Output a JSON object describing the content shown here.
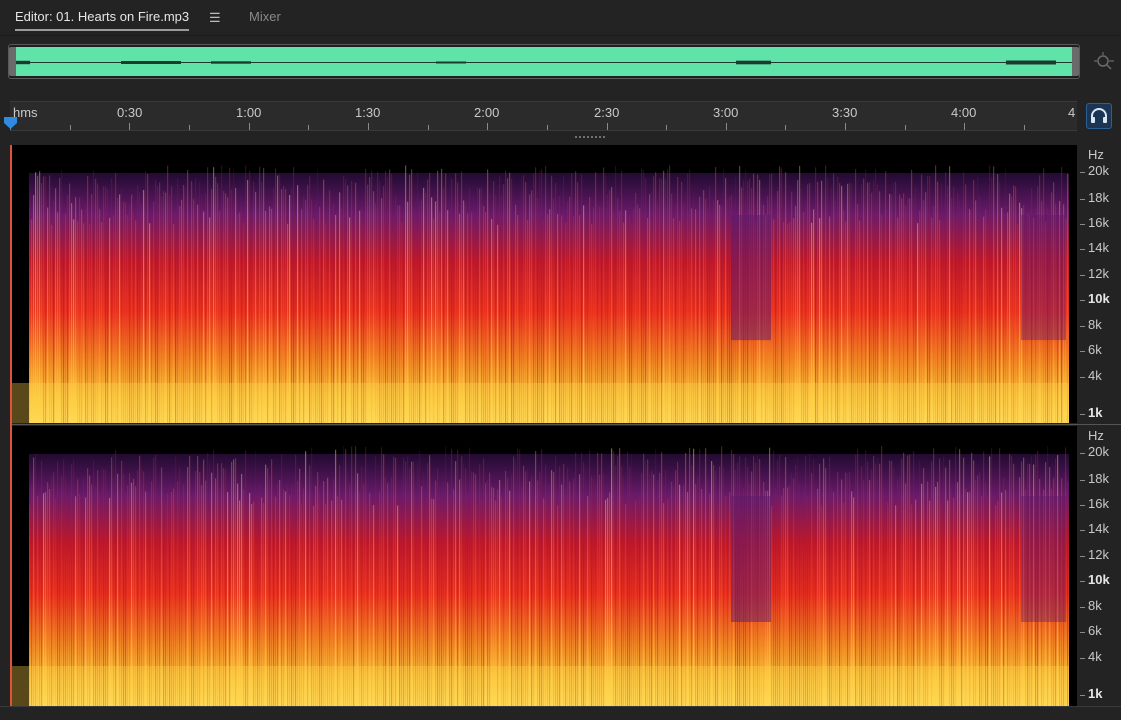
{
  "tabs": {
    "editor_label": "Editor: 01. Hearts on Fire.mp3",
    "menu_glyph": "☰",
    "mixer_label": "Mixer"
  },
  "overview": {
    "waveform_color": "#5fe3a8",
    "zoom_icon": "zoom-navigator-icon"
  },
  "ruler": {
    "unit_label": "hms",
    "labels": [
      "0:30",
      "1:00",
      "1:30",
      "2:00",
      "2:30",
      "3:00",
      "3:30",
      "4:00",
      "4"
    ]
  },
  "monitor_button": {
    "icon": "headphones-icon",
    "accent": "#2d5f93"
  },
  "frequency_scale": {
    "unit": "Hz",
    "labels": [
      "20k",
      "18k",
      "16k",
      "14k",
      "12k",
      "10k",
      "8k",
      "6k",
      "4k",
      "1k"
    ]
  },
  "colors": {
    "background": "#232323",
    "spectral_low": "#ffd24a",
    "spectral_mid": "#e8301e",
    "spectral_high": "#5a1a6e",
    "playhead": "#2f8ae0"
  }
}
